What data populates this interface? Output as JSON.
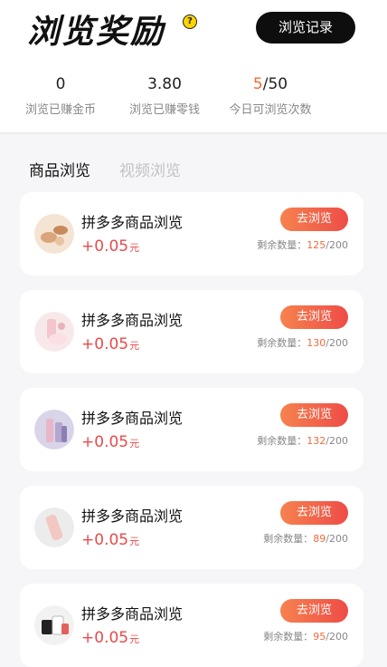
{
  "header": {
    "title": "浏览奖励",
    "help_icon": "?",
    "record_button": "浏览记录"
  },
  "stats": {
    "coins": {
      "value": "0",
      "label": "浏览已赚金币"
    },
    "cash": {
      "value": "3.80",
      "label": "浏览已赚零钱"
    },
    "views": {
      "used": "5",
      "total": "/50",
      "label": "今日可浏览次数"
    }
  },
  "tabs": {
    "goods": "商品浏览",
    "video": "视频浏览"
  },
  "items": [
    {
      "title": "拼多多商品浏览",
      "sign": "+",
      "amount": "0.05",
      "unit": "元",
      "button": "去浏览",
      "remain_label": "剩余数量：",
      "remain": "125",
      "remain_total": "/200"
    },
    {
      "title": "拼多多商品浏览",
      "sign": "+",
      "amount": "0.05",
      "unit": "元",
      "button": "去浏览",
      "remain_label": "剩余数量：",
      "remain": "130",
      "remain_total": "/200"
    },
    {
      "title": "拼多多商品浏览",
      "sign": "+",
      "amount": "0.05",
      "unit": "元",
      "button": "去浏览",
      "remain_label": "剩余数量：",
      "remain": "132",
      "remain_total": "/200"
    },
    {
      "title": "拼多多商品浏览",
      "sign": "+",
      "amount": "0.05",
      "unit": "元",
      "button": "去浏览",
      "remain_label": "剩余数量：",
      "remain": "89",
      "remain_total": "/200"
    },
    {
      "title": "拼多多商品浏览",
      "sign": "+",
      "amount": "0.05",
      "unit": "元",
      "button": "去浏览",
      "remain_label": "剩余数量：",
      "remain": "95",
      "remain_total": "/200"
    }
  ]
}
